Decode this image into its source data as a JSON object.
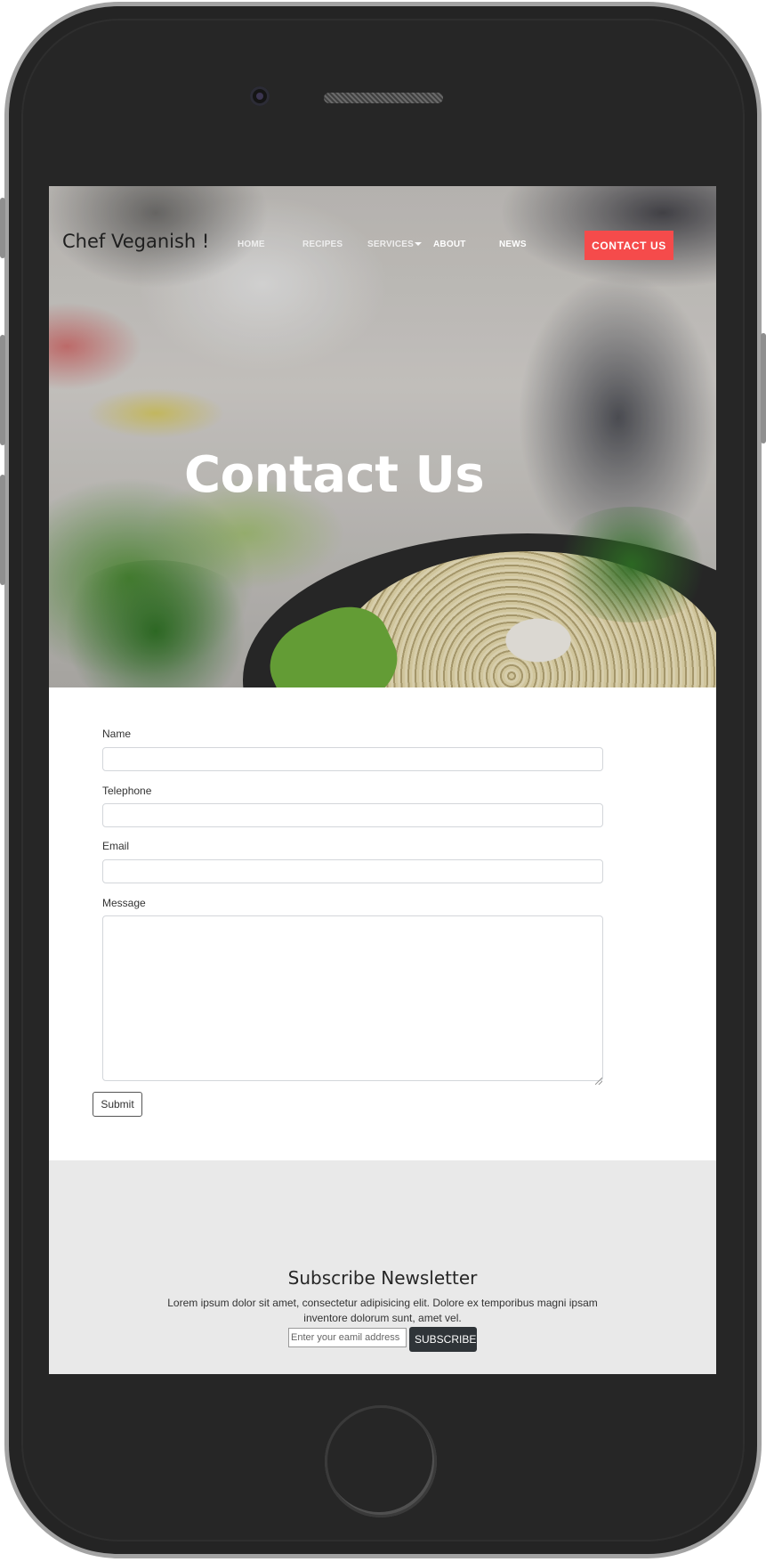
{
  "header": {
    "brand": "Chef Veganish !",
    "nav": {
      "home": "HOME",
      "recipes": "RECIPES",
      "services": "SERVICES",
      "about": "ABOUT",
      "news": "NEWS",
      "contact": "CONTACT US"
    },
    "accent_color": "#f54b4b"
  },
  "hero": {
    "title": "Contact Us"
  },
  "contact_form": {
    "name_label": "Name",
    "name_value": "",
    "telephone_label": "Telephone",
    "telephone_value": "",
    "email_label": "Email",
    "email_value": "",
    "message_label": "Message",
    "message_value": "",
    "submit_label": "Submit"
  },
  "newsletter": {
    "title": "Subscribe Newsletter",
    "text": "Lorem ipsum dolor sit amet, consectetur adipisicing elit. Dolore ex temporibus magni ipsam inventore dolorum sunt, amet vel.",
    "email_placeholder": "Enter your eamil address",
    "subscribe_label": "SUBSCRIBE",
    "button_color": "#2f3438"
  }
}
